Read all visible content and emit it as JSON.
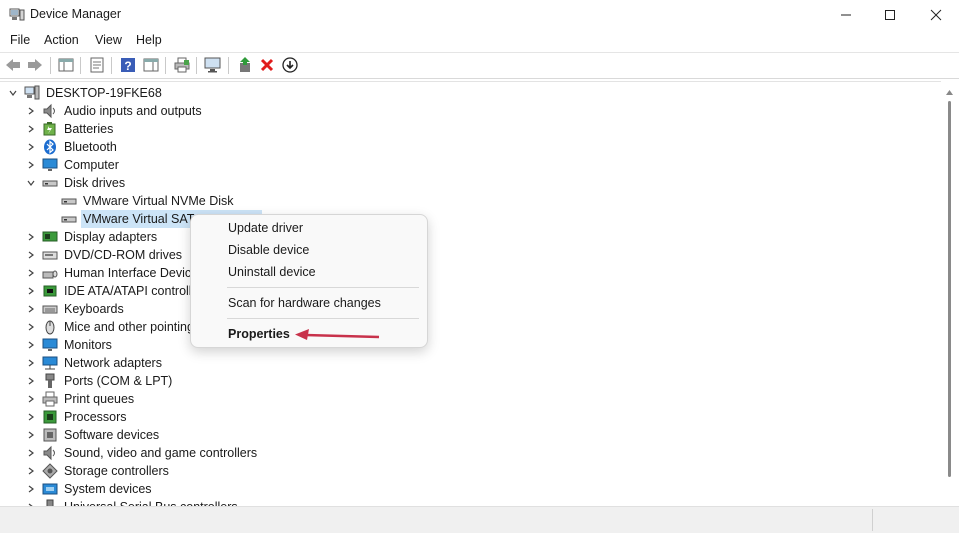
{
  "window": {
    "title": "Device Manager"
  },
  "menu": [
    "File",
    "Action",
    "View",
    "Help"
  ],
  "tree": {
    "root": "DESKTOP-19FKE68",
    "items": [
      {
        "label": "Audio inputs and outputs",
        "icon": "speaker-icon"
      },
      {
        "label": "Batteries",
        "icon": "battery-icon"
      },
      {
        "label": "Bluetooth",
        "icon": "bluetooth-icon"
      },
      {
        "label": "Computer",
        "icon": "monitor-icon"
      },
      {
        "label": "Disk drives",
        "icon": "disk-drive-icon",
        "expanded": true
      },
      {
        "label": "VMware Virtual NVMe Disk",
        "icon": "disk-drive-icon",
        "child": true
      },
      {
        "label": "VMware Virtual SATA",
        "icon": "disk-drive-icon",
        "child": true,
        "selected": true
      },
      {
        "label": "Display adapters",
        "icon": "display-adapter-icon"
      },
      {
        "label": "DVD/CD-ROM drives",
        "icon": "dvd-icon"
      },
      {
        "label": "Human Interface Device",
        "icon": "hid-icon"
      },
      {
        "label": "IDE ATA/ATAPI controlle",
        "icon": "ide-icon"
      },
      {
        "label": "Keyboards",
        "icon": "keyboard-icon"
      },
      {
        "label": "Mice and other pointing",
        "icon": "mouse-icon"
      },
      {
        "label": "Monitors",
        "icon": "monitor-icon"
      },
      {
        "label": "Network adapters",
        "icon": "network-icon"
      },
      {
        "label": "Ports (COM & LPT)",
        "icon": "port-icon"
      },
      {
        "label": "Print queues",
        "icon": "printer-icon"
      },
      {
        "label": "Processors",
        "icon": "processor-icon"
      },
      {
        "label": "Software devices",
        "icon": "software-device-icon"
      },
      {
        "label": "Sound, video and game controllers",
        "icon": "speaker-icon"
      },
      {
        "label": "Storage controllers",
        "icon": "storage-icon"
      },
      {
        "label": "System devices",
        "icon": "system-device-icon"
      },
      {
        "label": "Universal Serial Bus controllers",
        "icon": "usb-icon"
      }
    ]
  },
  "context_menu": {
    "update_driver": "Update driver",
    "disable_device": "Disable device",
    "uninstall_device": "Uninstall device",
    "scan_hardware": "Scan for hardware changes",
    "properties": "Properties"
  },
  "colors": {
    "selection": "#cce4f7",
    "arrow": "#c8324b",
    "uninstall_x": "#e01c1c"
  }
}
